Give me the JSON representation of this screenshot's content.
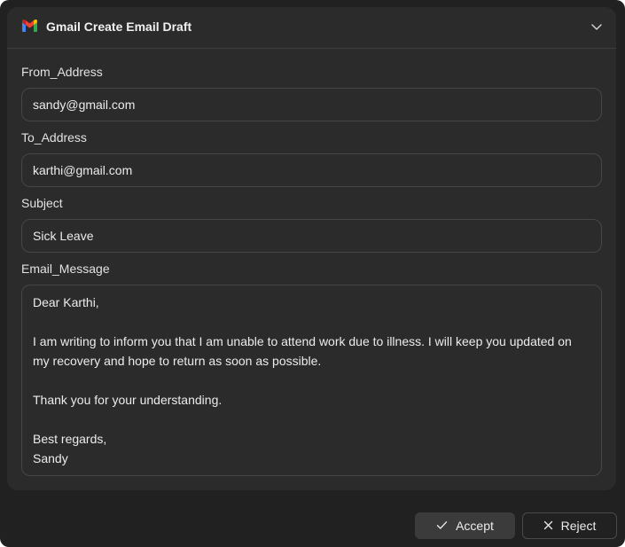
{
  "card": {
    "title": "Gmail Create Email Draft",
    "icon": "gmail-icon",
    "collapse_icon": "chevron-down-icon"
  },
  "fields": {
    "from": {
      "label": "From_Address",
      "value": "sandy@gmail.com"
    },
    "to": {
      "label": "To_Address",
      "value": "karthi@gmail.com"
    },
    "subject": {
      "label": "Subject",
      "value": "Sick Leave"
    },
    "message": {
      "label": "Email_Message",
      "value": "Dear Karthi,\n\nI am writing to inform you that I am unable to attend work due to illness. I will keep you updated on my recovery and hope to return as soon as possible.\n\nThank you for your understanding.\n\nBest regards,\nSandy"
    }
  },
  "actions": {
    "accept": {
      "label": "Accept",
      "icon": "check-icon"
    },
    "reject": {
      "label": "Reject",
      "icon": "close-icon"
    }
  },
  "colors": {
    "background": "#212121",
    "card": "#2b2b2b",
    "border": "#464646",
    "text": "#ececec",
    "gmail_red": "#ea4335",
    "gmail_blue": "#4285f4",
    "gmail_green": "#34a853",
    "gmail_yellow": "#fbbc04"
  }
}
